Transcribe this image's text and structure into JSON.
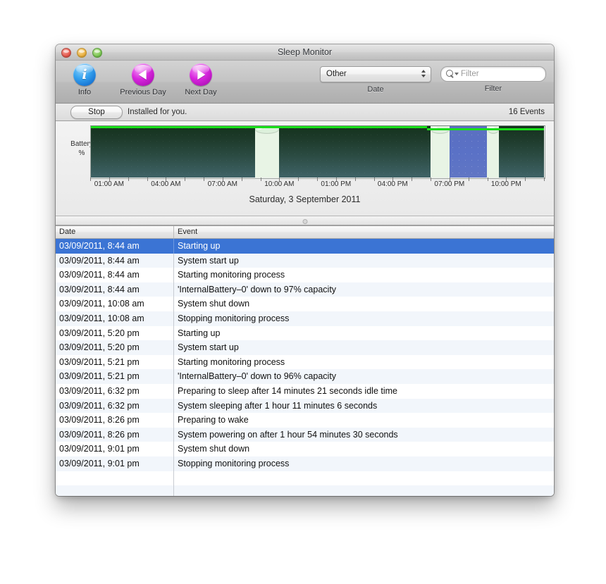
{
  "window": {
    "title": "Sleep Monitor",
    "traffic_lights": [
      "close-button",
      "minimize-button",
      "zoom-button"
    ]
  },
  "toolbar": {
    "items": [
      {
        "label": "Info",
        "icon": "info-icon"
      },
      {
        "label": "Previous Day",
        "icon": "previous-day-icon"
      },
      {
        "label": "Next Day",
        "icon": "next-day-icon"
      }
    ],
    "date_popup": {
      "value": "Other",
      "group_label": "Date",
      "icon": "popup-arrows-icon"
    },
    "filter": {
      "placeholder": "Filter",
      "value": "",
      "group_label": "Filter",
      "icon": "search-icon"
    }
  },
  "statusbar": {
    "stop_label": "Stop",
    "status_text": "Installed for you.",
    "events_count": "16 Events"
  },
  "chart_data": {
    "type": "area",
    "title": "Saturday, 3 September 2011",
    "ylabel": "Battery\n%",
    "ylabel_line1": "Battery",
    "ylabel_line2": "%",
    "xlabel": "",
    "xlim": [
      0,
      24
    ],
    "ylim": [
      0,
      100
    ],
    "grid": true,
    "legend": "none",
    "tick_labels": [
      "01:00 AM",
      "04:00 AM",
      "07:00 AM",
      "10:00 AM",
      "01:00 PM",
      "04:00 PM",
      "07:00 PM",
      "10:00 PM"
    ],
    "tick_hours": [
      1,
      4,
      7,
      10,
      13,
      16,
      19,
      22
    ],
    "minor_tick_hours": [
      0,
      1,
      2,
      3,
      4,
      5,
      6,
      7,
      8,
      9,
      10,
      11,
      12,
      13,
      14,
      15,
      16,
      17,
      18,
      19,
      20,
      21,
      22,
      23,
      24
    ],
    "series": [
      {
        "name": "Battery %",
        "color": "#19e019",
        "values": [
          97,
          97,
          97,
          97,
          97,
          97,
          97,
          96,
          96,
          96,
          96,
          96,
          96
        ]
      }
    ],
    "state_bands": [
      {
        "state": "running",
        "start_hour": 0.0,
        "end_hour": 8.73,
        "color": "#14321d"
      },
      {
        "state": "off",
        "start_hour": 8.73,
        "end_hour": 10.0,
        "color": "#ddf0dc"
      },
      {
        "state": "running",
        "start_hour": 10.0,
        "end_hour": 18.0,
        "color": "#14321d"
      },
      {
        "state": "off",
        "start_hour": 18.0,
        "end_hour": 19.0,
        "color": "#ddf0dc"
      },
      {
        "state": "sleeping",
        "start_hour": 19.0,
        "end_hour": 21.0,
        "color": "#5b6fc0"
      },
      {
        "state": "off",
        "start_hour": 21.0,
        "end_hour": 21.6,
        "color": "#ddf0dc"
      },
      {
        "state": "running",
        "start_hour": 21.6,
        "end_hour": 24.0,
        "color": "#14321d"
      }
    ]
  },
  "table": {
    "columns": [
      {
        "key": "date",
        "label": "Date"
      },
      {
        "key": "event",
        "label": "Event"
      }
    ],
    "selected_index": 0,
    "rows": [
      {
        "date": "03/09/2011, 8:44 am",
        "event": "Starting up"
      },
      {
        "date": "03/09/2011, 8:44 am",
        "event": "System start up"
      },
      {
        "date": "03/09/2011, 8:44 am",
        "event": "Starting monitoring process"
      },
      {
        "date": "03/09/2011, 8:44 am",
        "event": "'InternalBattery–0' down to 97% capacity"
      },
      {
        "date": "03/09/2011, 10:08 am",
        "event": "System shut down"
      },
      {
        "date": "03/09/2011, 10:08 am",
        "event": "Stopping monitoring process"
      },
      {
        "date": "03/09/2011, 5:20 pm",
        "event": "Starting up"
      },
      {
        "date": "03/09/2011, 5:20 pm",
        "event": "System start up"
      },
      {
        "date": "03/09/2011, 5:21 pm",
        "event": "Starting monitoring process"
      },
      {
        "date": "03/09/2011, 5:21 pm",
        "event": "'InternalBattery–0' down to 96% capacity"
      },
      {
        "date": "03/09/2011, 6:32 pm",
        "event": "Preparing to sleep after 14 minutes 21 seconds idle time"
      },
      {
        "date": "03/09/2011, 6:32 pm",
        "event": "System sleeping after 1 hour 11 minutes 6 seconds"
      },
      {
        "date": "03/09/2011, 8:26 pm",
        "event": "Preparing to wake"
      },
      {
        "date": "03/09/2011, 8:26 pm",
        "event": "System powering on after 1 hour 54 minutes 30 seconds"
      },
      {
        "date": "03/09/2011, 9:01 pm",
        "event": "System shut down"
      },
      {
        "date": "03/09/2011, 9:01 pm",
        "event": "Stopping monitoring process"
      }
    ],
    "empty_filler_rows": 3
  },
  "colors": {
    "selection_blue": "#3b74d4",
    "battery_line_green": "#19e019",
    "sleep_band_blue": "#5b6fc0",
    "off_band_green": "#ddf0dc",
    "running_band_dark": "#14321d"
  }
}
